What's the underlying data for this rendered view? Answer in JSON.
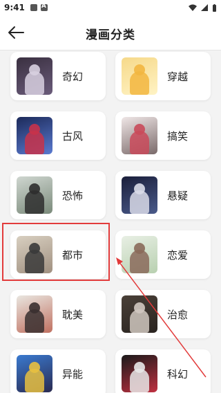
{
  "status": {
    "time": "9:41"
  },
  "header": {
    "title": "漫画分类"
  },
  "categories": [
    {
      "label": "奇幻",
      "cover_colors": [
        "#3a3040",
        "#d8d0e0",
        "#6a5b7a"
      ]
    },
    {
      "label": "穿越",
      "cover_colors": [
        "#f6d98a",
        "#f2b640",
        "#fff3c4"
      ]
    },
    {
      "label": "古风",
      "cover_colors": [
        "#1c2a5a",
        "#c8324a",
        "#5a7ad0"
      ]
    },
    {
      "label": "搞笑",
      "cover_colors": [
        "#efe6e6",
        "#c94a5a",
        "#7a6a6a"
      ]
    },
    {
      "label": "恐怖",
      "cover_colors": [
        "#cfd6d0",
        "#2e2e2e",
        "#7a8a7a"
      ]
    },
    {
      "label": "悬疑",
      "cover_colors": [
        "#1a1e3a",
        "#d9dbe8",
        "#4a5a8a"
      ]
    },
    {
      "label": "都市",
      "cover_colors": [
        "#d8cfc0",
        "#3a3a3a",
        "#a09080"
      ]
    },
    {
      "label": "恋爱",
      "cover_colors": [
        "#e8efe4",
        "#8a6a5a",
        "#b8d0b0"
      ]
    },
    {
      "label": "耽美",
      "cover_colors": [
        "#e9e6e0",
        "#3a3030",
        "#c07060"
      ]
    },
    {
      "label": "治愈",
      "cover_colors": [
        "#4a4038",
        "#d0c8c0",
        "#2a2420"
      ]
    },
    {
      "label": "异能",
      "cover_colors": [
        "#3a7ad0",
        "#e8c040",
        "#2a2a50"
      ]
    },
    {
      "label": "科幻",
      "cover_colors": [
        "#1a1a1a",
        "#e8e8e8",
        "#c03040"
      ]
    }
  ],
  "accent": "#e23b3b"
}
